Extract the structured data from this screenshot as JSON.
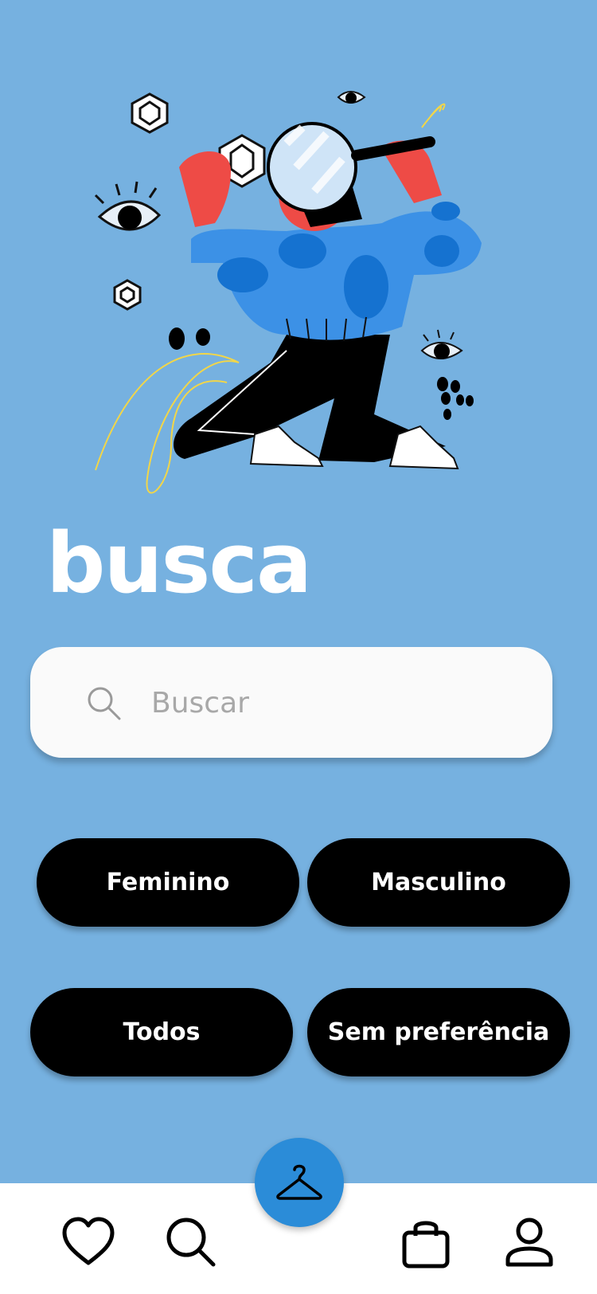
{
  "page": {
    "title": "busca"
  },
  "search": {
    "placeholder": "Buscar",
    "value": ""
  },
  "filters": [
    "Feminino",
    "Masculino",
    "Todos",
    "Sem preferência"
  ],
  "bottom_nav": {
    "items": [
      "heart-icon",
      "search-icon",
      "hanger-icon",
      "shopping-bag-icon",
      "user-icon"
    ]
  },
  "colors": {
    "background": "#76B1E0",
    "accent": "#2B8CD8",
    "button": "#000000",
    "button_text": "#FFFFFF",
    "nav_bar": "#FFFFFF"
  }
}
